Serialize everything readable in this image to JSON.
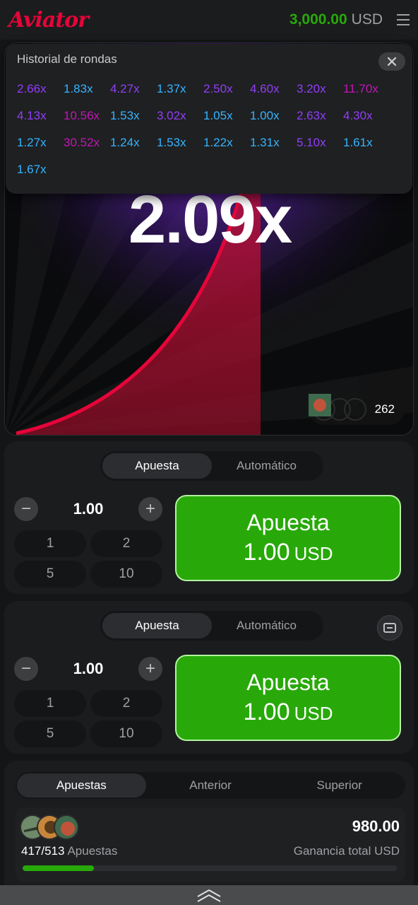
{
  "header": {
    "logo": "Aviator",
    "balance": "3,000.00",
    "currency": "USD"
  },
  "game": {
    "multiplier": "2.09x",
    "players_count": "262"
  },
  "history": {
    "title": "Historial de rondas",
    "items": [
      {
        "value": "2.66x",
        "color": "#913ef8"
      },
      {
        "value": "1.83x",
        "color": "#34b4ff"
      },
      {
        "value": "4.27x",
        "color": "#913ef8"
      },
      {
        "value": "1.37x",
        "color": "#34b4ff"
      },
      {
        "value": "2.50x",
        "color": "#913ef8"
      },
      {
        "value": "4.60x",
        "color": "#913ef8"
      },
      {
        "value": "3.20x",
        "color": "#913ef8"
      },
      {
        "value": "11.70x",
        "color": "#c017b4"
      },
      {
        "value": "4.13x",
        "color": "#913ef8"
      },
      {
        "value": "10.56x",
        "color": "#c017b4"
      },
      {
        "value": "1.53x",
        "color": "#34b4ff"
      },
      {
        "value": "3.02x",
        "color": "#913ef8"
      },
      {
        "value": "1.05x",
        "color": "#34b4ff"
      },
      {
        "value": "1.00x",
        "color": "#34b4ff"
      },
      {
        "value": "2.63x",
        "color": "#913ef8"
      },
      {
        "value": "4.30x",
        "color": "#913ef8"
      },
      {
        "value": "1.27x",
        "color": "#34b4ff"
      },
      {
        "value": "30.52x",
        "color": "#c017b4"
      },
      {
        "value": "1.24x",
        "color": "#34b4ff"
      },
      {
        "value": "1.53x",
        "color": "#34b4ff"
      },
      {
        "value": "1.22x",
        "color": "#34b4ff"
      },
      {
        "value": "1.31x",
        "color": "#34b4ff"
      },
      {
        "value": "5.10x",
        "color": "#913ef8"
      },
      {
        "value": "1.61x",
        "color": "#34b4ff"
      },
      {
        "value": "1.67x",
        "color": "#34b4ff"
      }
    ]
  },
  "bet1": {
    "tab_bet": "Apuesta",
    "tab_auto": "Automático",
    "amount": "1.00",
    "quick": [
      "1",
      "2",
      "5",
      "10"
    ],
    "button_line1": "Apuesta",
    "button_amount": "1.00",
    "button_currency": "USD"
  },
  "bet2": {
    "tab_bet": "Apuesta",
    "tab_auto": "Automático",
    "amount": "1.00",
    "quick": [
      "1",
      "2",
      "5",
      "10"
    ],
    "button_line1": "Apuesta",
    "button_amount": "1.00",
    "button_currency": "USD"
  },
  "bets_list": {
    "tabs": [
      "Apuestas",
      "Anterior",
      "Superior"
    ],
    "count": "417/513",
    "count_label": "Apuestas",
    "total": "980.00",
    "total_label": "Ganancia total USD",
    "progress_fraction": 0.19
  },
  "colors": {
    "accent_green": "#28a909",
    "brand_red": "#e50539",
    "low": "#34b4ff",
    "mid": "#913ef8",
    "high": "#c017b4"
  }
}
